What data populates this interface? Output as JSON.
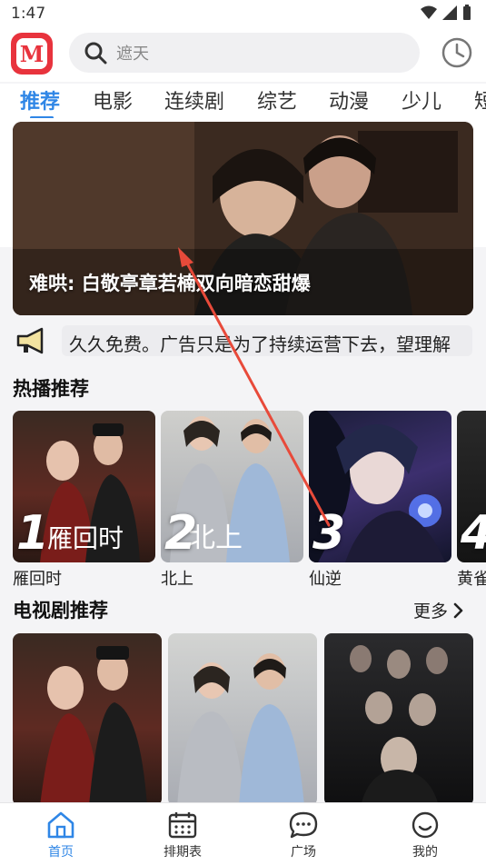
{
  "status": {
    "time": "1:47"
  },
  "search": {
    "placeholder": "遮天"
  },
  "tabs": [
    {
      "label": "推荐",
      "active": true
    },
    {
      "label": "电影"
    },
    {
      "label": "连续剧"
    },
    {
      "label": "综艺"
    },
    {
      "label": "动漫"
    },
    {
      "label": "少儿"
    },
    {
      "label": "短"
    }
  ],
  "banner": {
    "caption": "难哄: 白敬亭章若楠双向暗恋甜爆"
  },
  "notice": {
    "text": "久久免费。广告只是为了持续运营下去，望理解"
  },
  "hot": {
    "title": "热播推荐",
    "items": [
      {
        "rank": "1",
        "title": "雁回时"
      },
      {
        "rank": "2",
        "title": "北上"
      },
      {
        "rank": "3",
        "title": "仙逆"
      },
      {
        "rank": "4",
        "title": "黄雀"
      }
    ]
  },
  "tv": {
    "title": "电视剧推荐",
    "more": "更多"
  },
  "nav": [
    {
      "label": "首页",
      "icon": "home-icon",
      "active": true
    },
    {
      "label": "排期表",
      "icon": "calendar-icon"
    },
    {
      "label": "广场",
      "icon": "chat-bubble-icon"
    },
    {
      "label": "我的",
      "icon": "smiley-icon"
    }
  ],
  "colors": {
    "accent": "#2f86e6",
    "brand": "#e8333d",
    "annotation": "#e84a3a"
  }
}
